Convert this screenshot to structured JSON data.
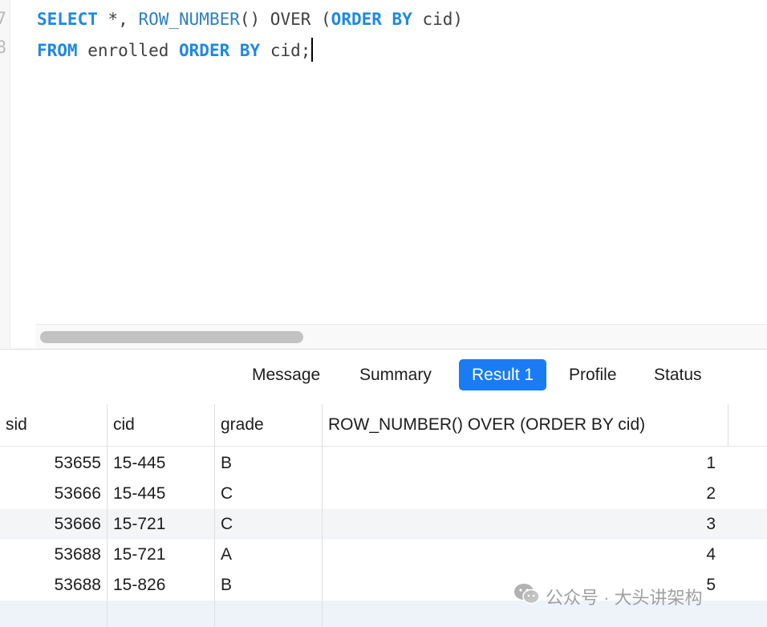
{
  "editor": {
    "line_numbers": [
      "7",
      "8"
    ],
    "lines": [
      [
        {
          "t": "SELECT",
          "c": "kw"
        },
        {
          "t": " *, ",
          "c": ""
        },
        {
          "t": "ROW_NUMBER",
          "c": "fn"
        },
        {
          "t": "() OVER (",
          "c": ""
        },
        {
          "t": "ORDER BY",
          "c": "kw"
        },
        {
          "t": " cid)",
          "c": ""
        }
      ],
      [
        {
          "t": "FROM",
          "c": "kw"
        },
        {
          "t": " enrolled ",
          "c": ""
        },
        {
          "t": "ORDER BY",
          "c": "kw"
        },
        {
          "t": " cid;",
          "c": ""
        }
      ]
    ]
  },
  "tabs": [
    {
      "label": "Message",
      "active": false
    },
    {
      "label": "Summary",
      "active": false
    },
    {
      "label": "Result 1",
      "active": true
    },
    {
      "label": "Profile",
      "active": false
    },
    {
      "label": "Status",
      "active": false
    }
  ],
  "grid": {
    "columns": [
      "sid",
      "cid",
      "grade",
      "ROW_NUMBER() OVER (ORDER BY cid)"
    ],
    "rows": [
      [
        "53655",
        "15-445",
        "B",
        "1"
      ],
      [
        "53666",
        "15-445",
        "C",
        "2"
      ],
      [
        "53666",
        "15-721",
        "C",
        "3"
      ],
      [
        "53688",
        "15-721",
        "A",
        "4"
      ],
      [
        "53688",
        "15-826",
        "B",
        "5"
      ]
    ]
  },
  "watermark": {
    "text": "公众号 · 大头讲架构",
    "icon": "wechat-icon"
  },
  "colors": {
    "keyword": "#1e88e5",
    "active_tab": "#1a7cf5",
    "alt_row": "#f4f5f7"
  }
}
